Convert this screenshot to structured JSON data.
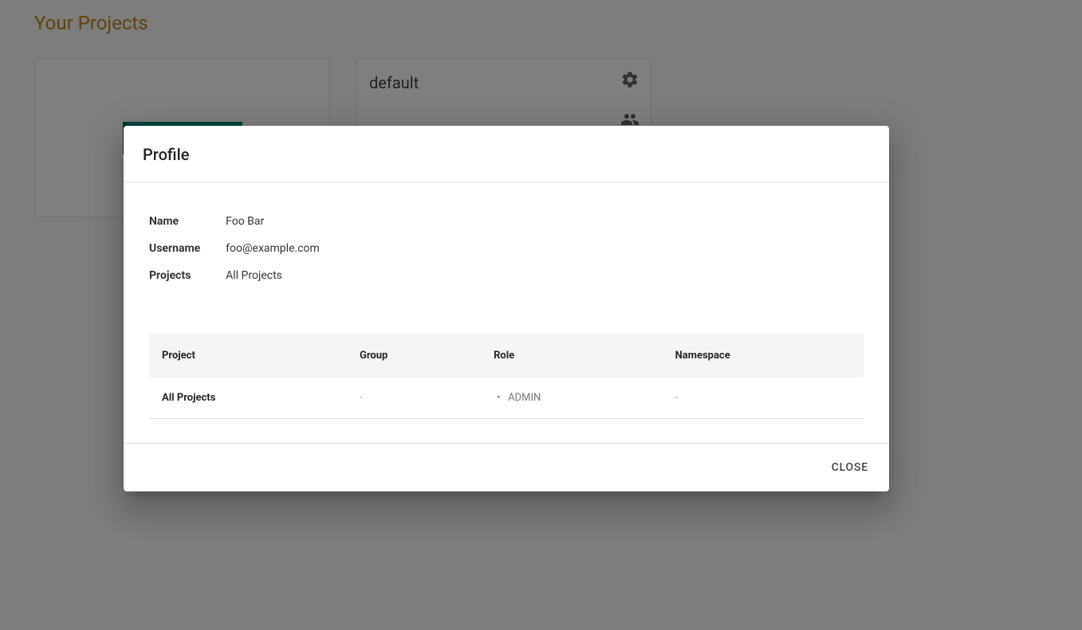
{
  "page": {
    "title": "Your Projects"
  },
  "projects": [
    {
      "name": "default"
    }
  ],
  "dialog": {
    "title": "Profile",
    "info": {
      "name_label": "Name",
      "name_value": "Foo Bar",
      "username_label": "Username",
      "username_value": "foo@example.com",
      "projects_label": "Projects",
      "projects_value": "All Projects"
    },
    "table": {
      "headers": {
        "project": "Project",
        "group": "Group",
        "role": "Role",
        "namespace": "Namespace"
      },
      "rows": [
        {
          "project": "All Projects",
          "group": "-",
          "roles": [
            "ADMIN"
          ],
          "namespace": "-"
        }
      ]
    },
    "close_label": "CLOSE"
  }
}
